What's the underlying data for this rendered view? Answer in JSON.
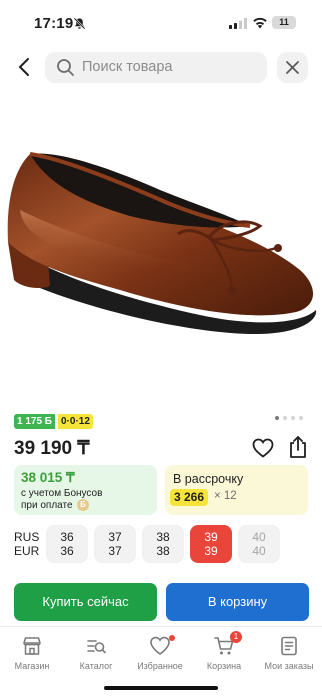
{
  "status_bar": {
    "time": "17:19",
    "battery": "11"
  },
  "search": {
    "placeholder": "Поиск товара"
  },
  "product": {
    "image_icon": "shoe-image",
    "badge_bonus": "1 175 Б",
    "badge_installment": "0·0·12",
    "price": "39 190 ₸"
  },
  "bonus_card": {
    "price": "38 015 ₸",
    "line1": "с учетом Бонусов",
    "line2": "при оплате",
    "coin": "Б"
  },
  "installment_card": {
    "title": "В рассрочку",
    "amount": "3 266",
    "multiplier": "× 12"
  },
  "sizes": {
    "label_rus": "RUS",
    "label_eur": "EUR",
    "items": [
      {
        "rus": "36",
        "eur": "36",
        "state": "normal"
      },
      {
        "rus": "37",
        "eur": "37",
        "state": "normal"
      },
      {
        "rus": "38",
        "eur": "38",
        "state": "normal"
      },
      {
        "rus": "39",
        "eur": "39",
        "state": "selected"
      },
      {
        "rus": "40",
        "eur": "40",
        "state": "unavailable"
      }
    ]
  },
  "actions": {
    "buy_now": "Купить сейчас",
    "add_to_cart": "В корзину"
  },
  "tab_bar": {
    "items": [
      {
        "label": "Магазин",
        "icon": "shop-icon"
      },
      {
        "label": "Каталог",
        "icon": "catalog-icon"
      },
      {
        "label": "Избранное",
        "icon": "heart-icon"
      },
      {
        "label": "Корзина",
        "icon": "cart-icon",
        "badge": "1"
      },
      {
        "label": "Мои заказы",
        "icon": "orders-icon"
      }
    ]
  },
  "colors": {
    "buy_button": "#1fa046",
    "cart_button": "#1f6fd1",
    "selected_size": "#e9453a",
    "bonus_green": "#3eb551",
    "installment_yellow": "#f7e43a"
  }
}
